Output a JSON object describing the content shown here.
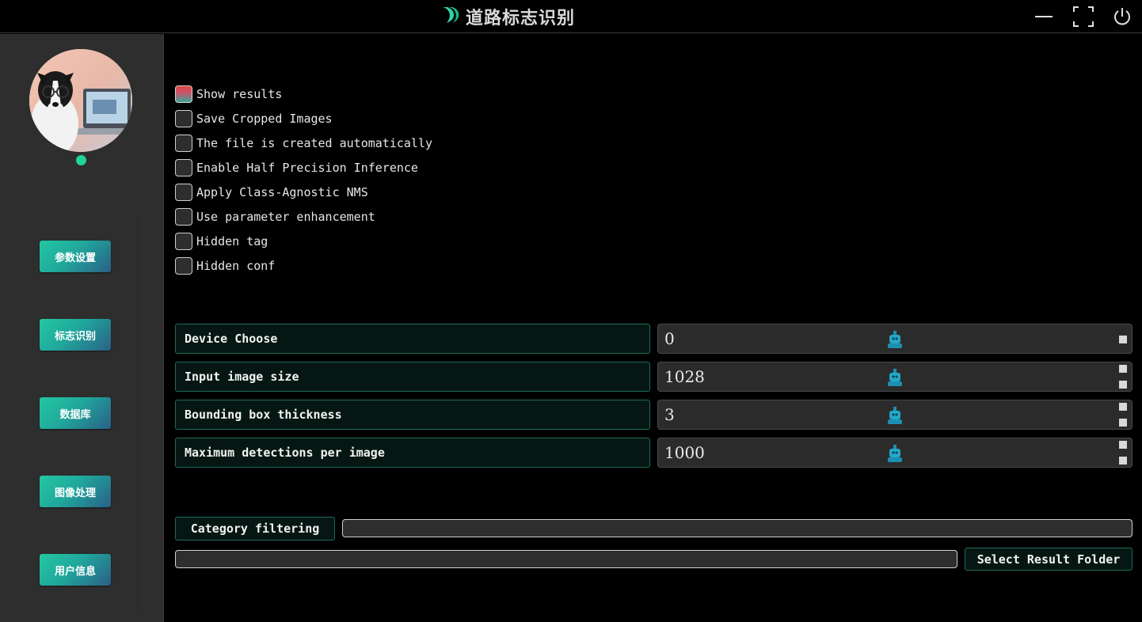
{
  "window": {
    "title": "道路标志识别",
    "logo_icon": "crescent-leaf-icon",
    "controls": [
      "minimize-icon",
      "maximize-icon",
      "power-icon"
    ]
  },
  "sidebar": {
    "status_color": "#1fd49a",
    "nav": [
      {
        "label": "参数设置"
      },
      {
        "label": "标志识别"
      },
      {
        "label": "数据库"
      },
      {
        "label": "图像处理"
      },
      {
        "label": "用户信息"
      }
    ]
  },
  "options": [
    {
      "label": "Show results",
      "checked": true
    },
    {
      "label": "Save Cropped Images",
      "checked": false
    },
    {
      "label": "The file is created automatically",
      "checked": false
    },
    {
      "label": "Enable Half Precision Inference",
      "checked": false
    },
    {
      "label": "Apply Class-Agnostic NMS",
      "checked": false
    },
    {
      "label": "Use parameter enhancement",
      "checked": false
    },
    {
      "label": "Hidden tag",
      "checked": false
    },
    {
      "label": "Hidden conf",
      "checked": false
    }
  ],
  "params": [
    {
      "label": "Device Choose",
      "value": "0"
    },
    {
      "label": "Input image size",
      "value": "1028"
    },
    {
      "label": "Bounding box thickness",
      "value": "3"
    },
    {
      "label": "Maximum detections per image",
      "value": "1000"
    }
  ],
  "filter": {
    "category_label": "Category filtering",
    "category_value": "",
    "result_folder_value": "",
    "select_folder_label": "Select Result Folder"
  },
  "colors": {
    "accent_teal": "#23c7a2",
    "accent_blue": "#2a5f87",
    "checked_red": "#e0423e"
  }
}
